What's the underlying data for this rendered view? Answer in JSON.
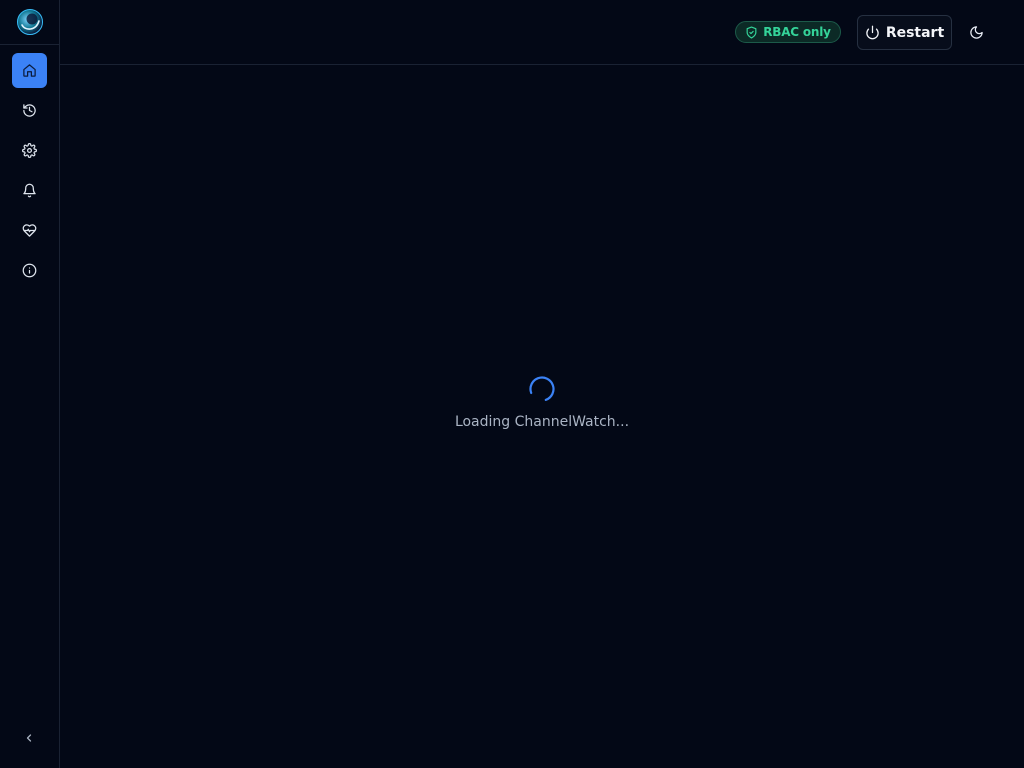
{
  "app": {
    "name": "ChannelWatch",
    "logo_icon": "channelwatch-logo-icon"
  },
  "sidebar": {
    "items": [
      {
        "id": "home",
        "icon": "home-icon",
        "active": true
      },
      {
        "id": "history",
        "icon": "history-icon",
        "active": false
      },
      {
        "id": "settings",
        "icon": "gear-icon",
        "active": false
      },
      {
        "id": "notifications",
        "icon": "bell-icon",
        "active": false
      },
      {
        "id": "health",
        "icon": "heart-pulse-icon",
        "active": false
      },
      {
        "id": "about",
        "icon": "info-icon",
        "active": false
      }
    ],
    "collapse_icon": "chevron-left-icon"
  },
  "header": {
    "badge_label": "RBAC only",
    "badge_icon": "shield-check-icon",
    "restart_label": "Restart",
    "restart_icon": "power-icon",
    "theme_icon": "moon-icon"
  },
  "main": {
    "loading_text": "Loading ChannelWatch..."
  },
  "colors": {
    "background": "#030816",
    "accent": "#3b82f6",
    "badge_green": "#34d399",
    "border": "#1a2233"
  }
}
